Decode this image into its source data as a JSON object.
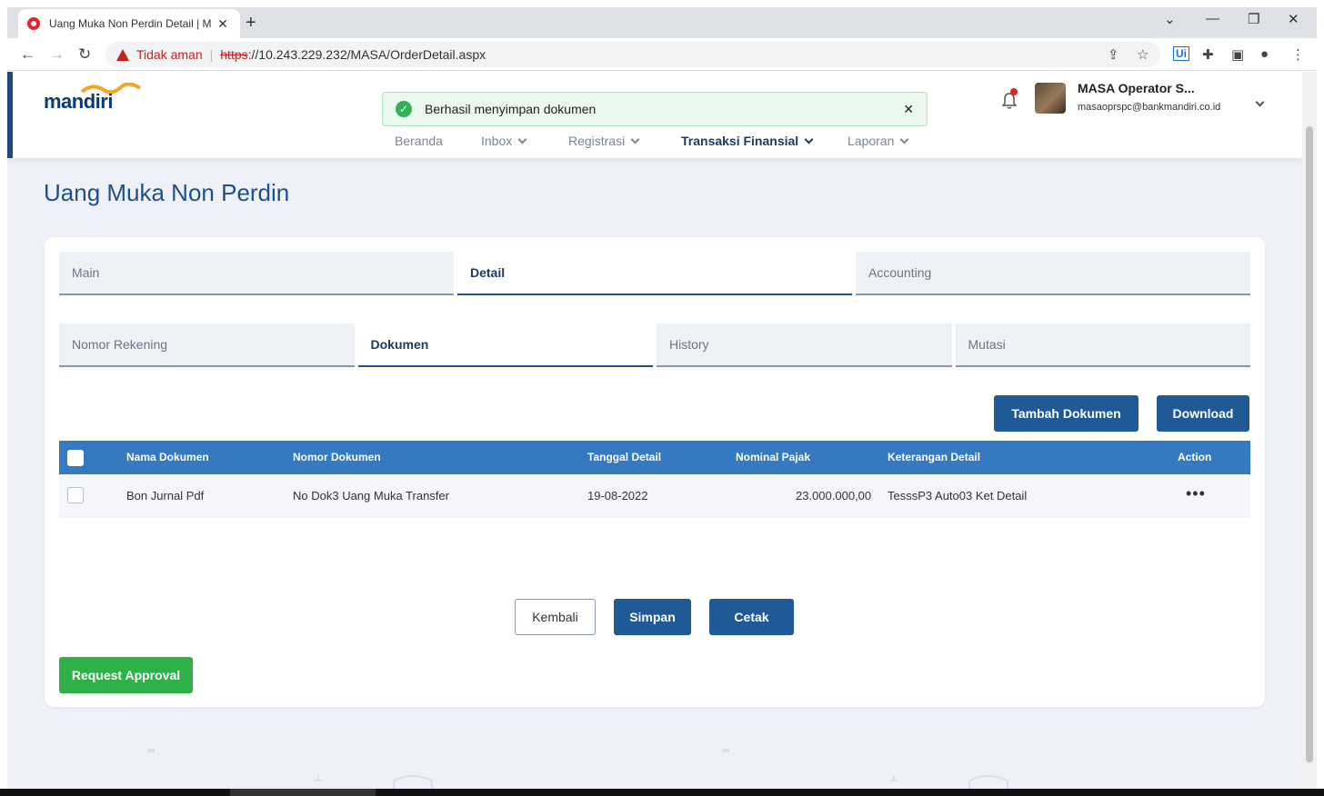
{
  "browser": {
    "tab_title": "Uang Muka Non Perdin Detail | M",
    "not_secure_label": "Tidak aman",
    "url_scheme": "https",
    "url_rest": "://10.243.229.232/MASA/OrderDetail.aspx"
  },
  "header": {
    "logo_text": "mandiri",
    "toast_message": "Berhasil menyimpan dokumen",
    "menu": [
      {
        "label": "Beranda"
      },
      {
        "label": "Inbox"
      },
      {
        "label": "Registrasi"
      },
      {
        "label": "Transaksi Finansial"
      },
      {
        "label": "Laporan"
      }
    ],
    "user_name": "MASA Operator S...",
    "user_email": "masaoprspc@bankmandiri.co.id"
  },
  "page_title": "Uang Muka Non Perdin",
  "tabs_main": [
    {
      "label": "Main"
    },
    {
      "label": "Detail"
    },
    {
      "label": "Accounting"
    }
  ],
  "tabs_detail": [
    {
      "label": "Nomor Rekening"
    },
    {
      "label": "Dokumen"
    },
    {
      "label": "History"
    },
    {
      "label": "Mutasi"
    }
  ],
  "actions": {
    "add_document": "Tambah Dokumen",
    "download": "Download"
  },
  "table": {
    "headers": [
      "Nama Dokumen",
      "Nomor Dokumen",
      "Tanggal Detail",
      "Nominal Pajak",
      "Keterangan Detail",
      "Action"
    ],
    "rows": [
      [
        "Bon Jurnal Pdf",
        "No Dok3 Uang Muka Transfer",
        "19-08-2022",
        "23.000.000,00",
        "TesssP3 Auto03 Ket Detail",
        "•••"
      ]
    ]
  },
  "footer_buttons": {
    "back": "Kembali",
    "save": "Simpan",
    "print": "Cetak",
    "request_approval": "Request Approval"
  },
  "colors": {
    "primary": "#1f5a96",
    "table_header": "#3579c0",
    "title": "#1f4f86",
    "success": "#2fb14a",
    "page_bg": "#eef2f8"
  }
}
